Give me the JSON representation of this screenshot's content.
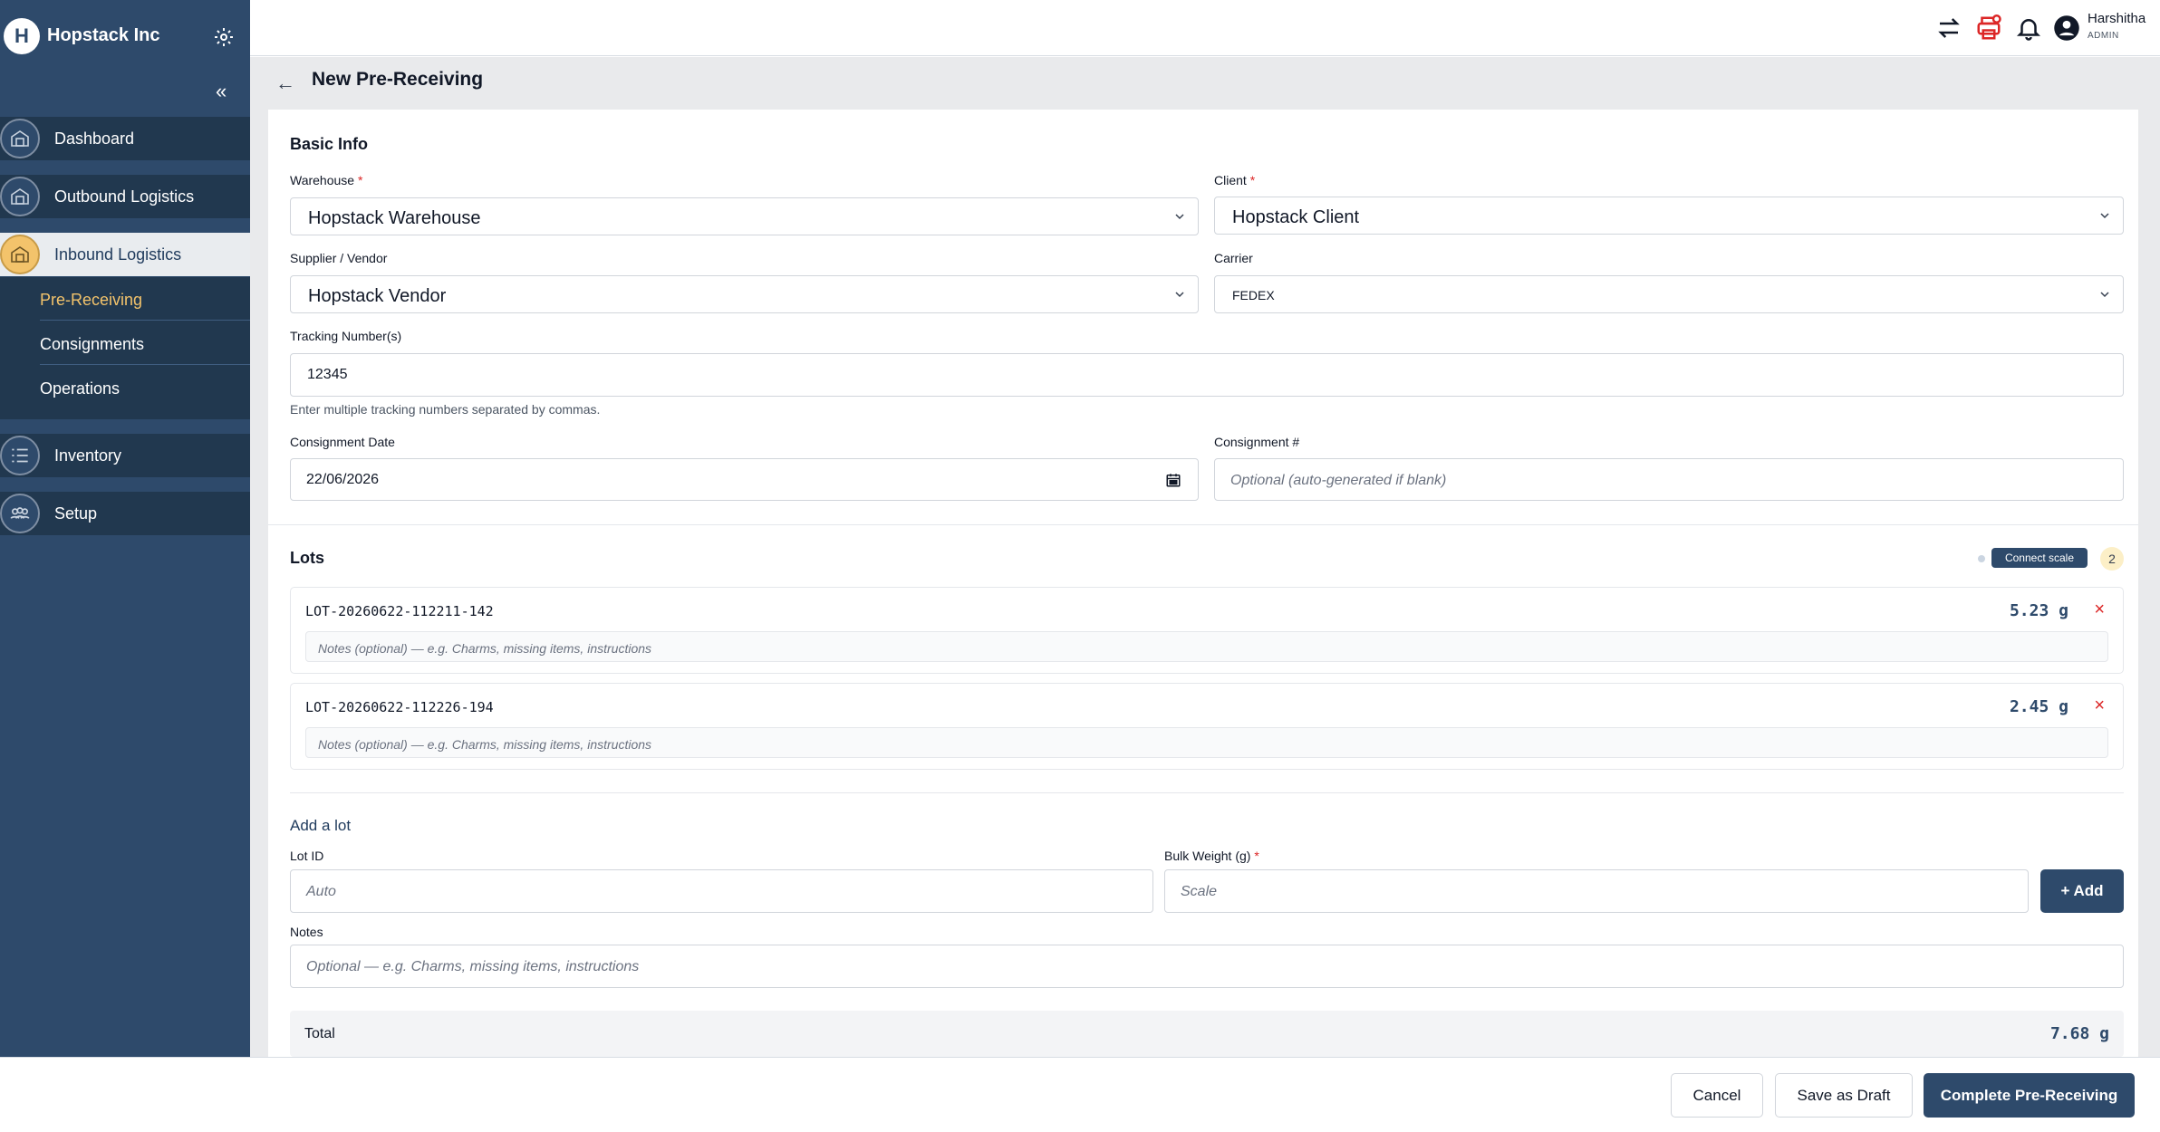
{
  "brand": {
    "logo_letter": "H",
    "name": "Hopstack Inc"
  },
  "sidebar": {
    "items": [
      {
        "label": "Dashboard"
      },
      {
        "label": "Outbound Logistics"
      },
      {
        "label": "Inbound Logistics"
      },
      {
        "label": "Inventory"
      },
      {
        "label": "Setup"
      }
    ],
    "sub_items": [
      {
        "label": "Pre-Receiving"
      },
      {
        "label": "Consignments"
      },
      {
        "label": "Operations"
      }
    ],
    "collapse_glyph": "«"
  },
  "topbar": {
    "user_name": "Harshitha",
    "user_role": "ADMIN",
    "icons": [
      "swap-icon",
      "printer-icon",
      "bell-icon",
      "user-avatar-icon"
    ]
  },
  "header": {
    "back_glyph": "←",
    "title": "New Pre-Receiving"
  },
  "basic_info": {
    "title": "Basic Info",
    "warehouse_label": "Warehouse",
    "warehouse_value": "Hopstack Warehouse",
    "client_label": "Client",
    "client_value": "Hopstack Client",
    "supplier_label": "Supplier / Vendor",
    "supplier_value": "Hopstack Vendor",
    "carrier_label": "Carrier",
    "carrier_value": "FEDEX",
    "tracking_label": "Tracking Number(s)",
    "tracking_value": "12345",
    "tracking_hint": "Enter multiple tracking numbers separated by commas.",
    "consignment_date_label": "Consignment Date",
    "consignment_date_value": "22/06/2026",
    "consignment_no_label": "Consignment #",
    "consignment_no_placeholder": "Optional (auto-generated if blank)",
    "required_mark": "*"
  },
  "lots": {
    "title": "Lots",
    "connect_scale_label": "Connect scale",
    "count": "2",
    "items": [
      {
        "id": "LOT-20260622-112211-142",
        "weight": "5.23 g",
        "notes_placeholder": "Notes (optional) — e.g. Charms, missing items, instructions"
      },
      {
        "id": "LOT-20260622-112226-194",
        "weight": "2.45 g",
        "notes_placeholder": "Notes (optional) — e.g. Charms, missing items, instructions"
      }
    ],
    "remove_glyph": "×"
  },
  "add_lot": {
    "title": "Add a lot",
    "lot_id_label": "Lot ID",
    "lot_id_placeholder": "Auto",
    "bulk_weight_label": "Bulk Weight (g)",
    "bulk_weight_placeholder": "Scale",
    "add_button": "+ Add",
    "notes_label": "Notes",
    "notes_placeholder": "Optional — e.g. Charms, missing items, instructions"
  },
  "total": {
    "label": "Total",
    "value": "7.68 g"
  },
  "footer": {
    "cancel": "Cancel",
    "save_draft": "Save as Draft",
    "complete": "Complete Pre-Receiving"
  },
  "colors": {
    "sidebar": "#2e4a6b",
    "sidebar_dark": "#21384f",
    "accent": "#f3c36b",
    "danger": "#dc2626"
  }
}
